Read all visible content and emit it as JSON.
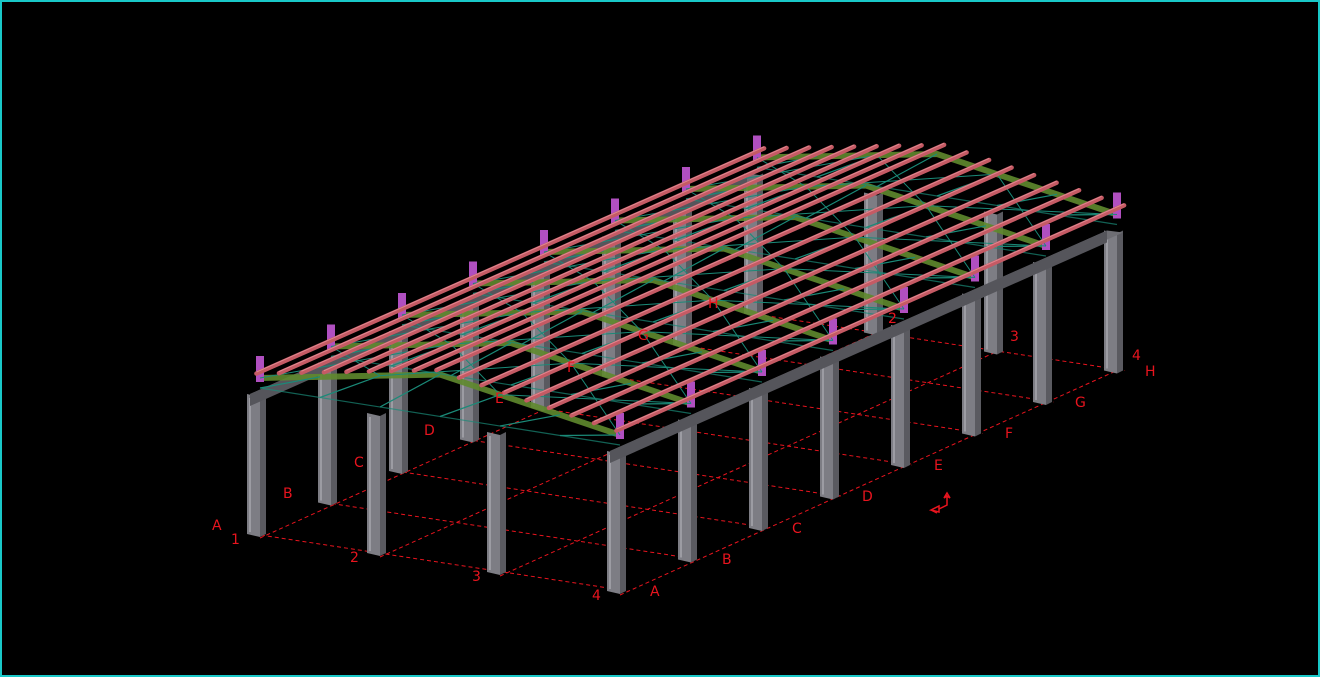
{
  "view": {
    "border_color": "#19c8c8",
    "background": "#000000",
    "grid_color": "#e8141e"
  },
  "grid": {
    "numbered_axes": [
      "1",
      "2",
      "3",
      "4"
    ],
    "lettered_axes": [
      "A",
      "B",
      "C",
      "D",
      "E",
      "F",
      "G",
      "H"
    ],
    "near_letters": [
      "A",
      "B",
      "C",
      "D"
    ],
    "far_letters": [
      "E",
      "F",
      "G",
      "H"
    ],
    "far_numbers": [
      "2",
      "3",
      "4"
    ]
  },
  "icons": {
    "ucs": "ucs-axis-icon"
  },
  "colors": {
    "column": "#7d7d84",
    "column_light": "#a6a6ad",
    "beam": "#6e6e74",
    "purlin": "#c55a64",
    "rafter": "#5f8a2e",
    "brace": "#1a8a78",
    "connection": "#b04fc0"
  }
}
